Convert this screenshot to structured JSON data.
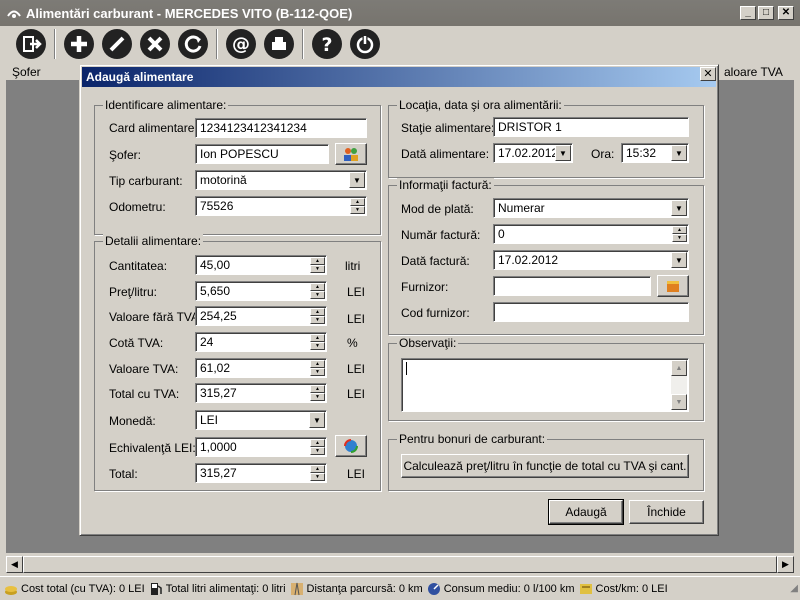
{
  "window": {
    "title": "Alimentări carburant - MERCEDES VITO (B-112-QOE)"
  },
  "toolbar": {
    "icons": [
      "exit-icon",
      "add-icon",
      "edit-icon",
      "delete-icon",
      "refresh-icon",
      "email-icon",
      "print-icon",
      "help-icon",
      "power-icon"
    ]
  },
  "grid": {
    "col_driver": "Şofer",
    "col_vat": "aloare TVA"
  },
  "dialog": {
    "title": "Adaugă alimentare",
    "ident": {
      "legend": "Identificare alimentare:",
      "card_label": "Card alimentare:",
      "card_value": "1234123412341234",
      "driver_label": "Şofer:",
      "driver_value": "Ion POPESCU",
      "fuel_label": "Tip carburant:",
      "fuel_value": "motorină",
      "odo_label": "Odometru:",
      "odo_value": "75526"
    },
    "details": {
      "legend": "Detalii alimentare:",
      "qty_label": "Cantitatea:",
      "qty_value": "45,00",
      "qty_unit": "litri",
      "price_label": "Preţ/litru:",
      "price_value": "5,650",
      "price_unit": "LEI",
      "net_label": "Valoare fără TVA:",
      "net_value": "254,25",
      "net_unit": "LEI",
      "vatrate_label": "Cotă TVA:",
      "vatrate_value": "24",
      "vatrate_unit": "%",
      "vat_label": "Valoare TVA:",
      "vat_value": "61,02",
      "vat_unit": "LEI",
      "gross_label": "Total cu TVA:",
      "gross_value": "315,27",
      "gross_unit": "LEI",
      "currency_label": "Monedă:",
      "currency_value": "LEI",
      "rate_label": "Echivalenţă LEI:",
      "rate_value": "1,0000",
      "total_label": "Total:",
      "total_value": "315,27",
      "total_unit": "LEI"
    },
    "location": {
      "legend": "Locaţia, data şi ora alimentării:",
      "station_label": "Staţie alimentare:",
      "station_value": "DRISTOR 1",
      "date_label": "Dată alimentare:",
      "date_value": "17.02.2012",
      "time_label": "Ora:",
      "time_value": "15:32"
    },
    "invoice": {
      "legend": "Informaţii factură:",
      "pay_label": "Mod de plată:",
      "pay_value": "Numerar",
      "num_label": "Număr factură:",
      "num_value": "0",
      "date_label": "Dată factură:",
      "date_value": "17.02.2012",
      "supplier_label": "Furnizor:",
      "supplier_value": "",
      "supcode_label": "Cod furnizor:",
      "supcode_value": ""
    },
    "notes": {
      "legend": "Observaţii:",
      "value": ""
    },
    "coupons": {
      "legend": "Pentru bonuri de carburant:",
      "calc_button": "Calculează preţ/litru în funcţie de total cu TVA şi cant."
    },
    "add_button": "Adaugă",
    "close_button": "Închide"
  },
  "status": {
    "total_cost": "Cost total (cu TVA): 0 LEI",
    "total_liters": "Total litri alimentaţi: 0 litri",
    "distance": "Distanţa parcursă: 0 km",
    "consumption": "Consum mediu: 0 l/100 km",
    "cost_km": "Cost/km: 0 LEI"
  }
}
